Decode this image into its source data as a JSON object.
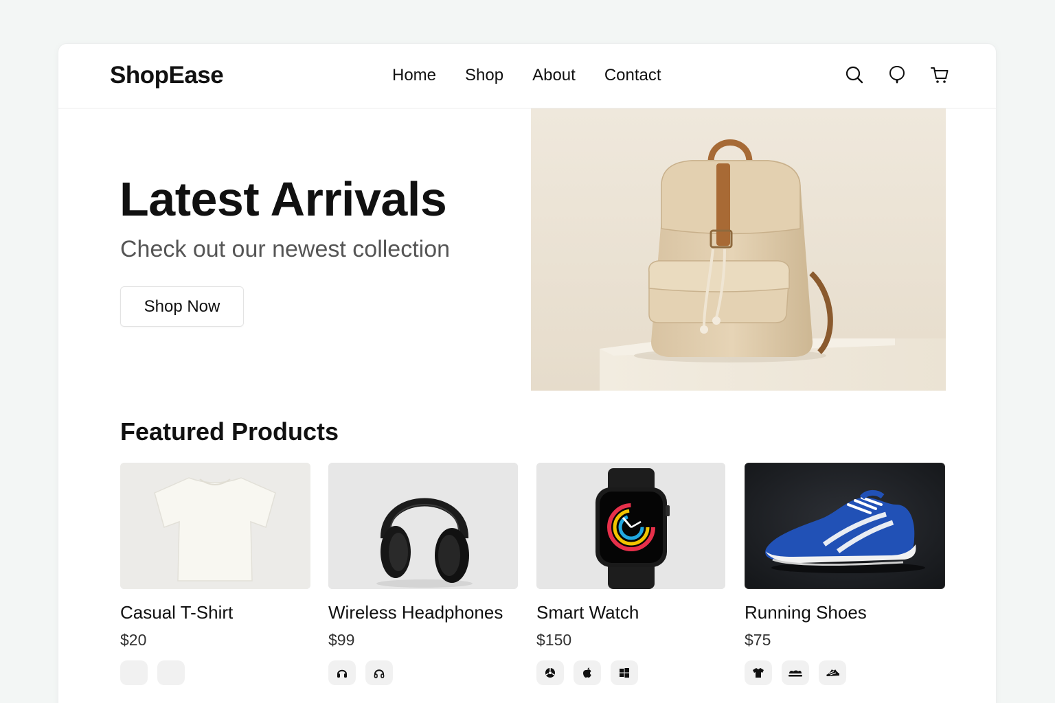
{
  "app": {
    "logo": "ShopEase"
  },
  "nav": [
    "Home",
    "Shop",
    "About",
    "Contact"
  ],
  "header_icons": [
    "search-icon",
    "chat-bubble-icon",
    "cart-icon"
  ],
  "hero": {
    "title": "Latest Arrivals",
    "subtitle": "Check out our newest collection",
    "cta": "Shop Now",
    "image": "backpack-photo"
  },
  "featured": {
    "title": "Featured Products",
    "products": [
      {
        "name": "Casual T-Shirt",
        "price": "$20",
        "image": "tshirt-photo",
        "chips": [
          "blank",
          "blank"
        ]
      },
      {
        "name": "Wireless Headphones",
        "price": "$99",
        "image": "headphones-photo",
        "chips": [
          "headphone-icon",
          "headset-icon"
        ]
      },
      {
        "name": "Smart Watch",
        "price": "$150",
        "image": "smartwatch-photo",
        "chips": [
          "android-icon",
          "apple-icon",
          "windows-icon"
        ]
      },
      {
        "name": "Running Shoes",
        "price": "$75",
        "image": "sneaker-photo",
        "chips": [
          "shirt-icon",
          "sandal-icon",
          "shoe-icon"
        ]
      }
    ]
  },
  "colors": {
    "background": "#f3f6f5",
    "text": "#111111",
    "muted": "#555555",
    "chip": "#f1f1f1",
    "shoe_blue": "#1f4fb0"
  }
}
